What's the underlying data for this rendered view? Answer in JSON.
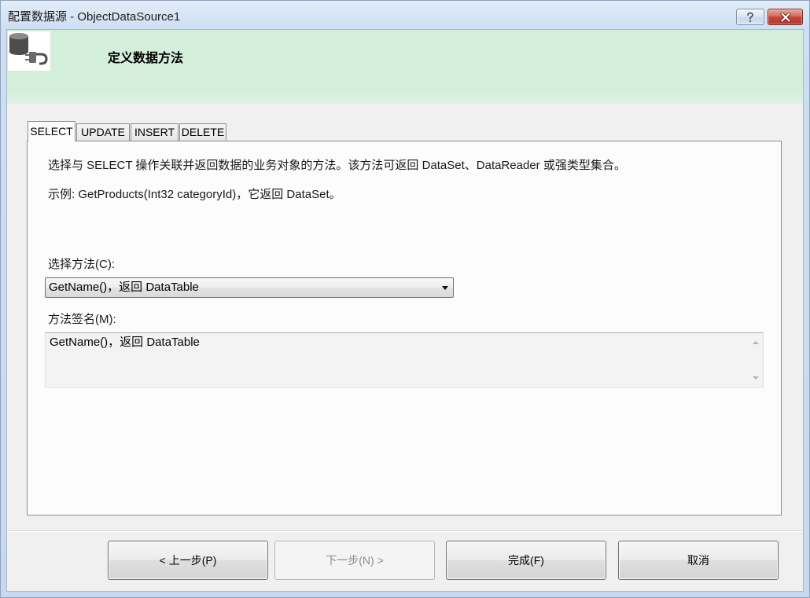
{
  "window": {
    "title": "配置数据源 - ObjectDataSource1",
    "help_icon": "help-icon",
    "close_icon": "close-icon"
  },
  "header": {
    "icon": "database-plug-icon",
    "title": "定义数据方法"
  },
  "tabs": [
    {
      "label": "SELECT",
      "selected": true
    },
    {
      "label": "UPDATE",
      "selected": false
    },
    {
      "label": "INSERT",
      "selected": false
    },
    {
      "label": "DELETE",
      "selected": false
    }
  ],
  "select_tab": {
    "description": "选择与 SELECT 操作关联并返回数据的业务对象的方法。该方法可返回 DataSet、DataReader 或强类型集合。",
    "example": "示例: GetProducts(Int32 categoryId)，它返回 DataSet。",
    "method_label": "选择方法(C):",
    "method_value": "GetName()，返回 DataTable",
    "method_icon": "chevron-down-icon",
    "signature_label": "方法签名(M):",
    "signature_value": "GetName()，返回 DataTable",
    "scroll_icons": [
      "scroll-up-icon",
      "scroll-down-icon"
    ]
  },
  "buttons": {
    "back": {
      "label": "< 上一步(P)",
      "enabled": true
    },
    "next": {
      "label": "下一步(N) >",
      "enabled": false
    },
    "finish": {
      "label": "完成(F)",
      "enabled": true
    },
    "cancel": {
      "label": "取消",
      "enabled": true
    }
  },
  "colors": {
    "title_bar": "#cddff2",
    "header_bg": "#d4eedc",
    "dialog_bg": "#f0f0f0",
    "close_button": "#c7463b"
  }
}
